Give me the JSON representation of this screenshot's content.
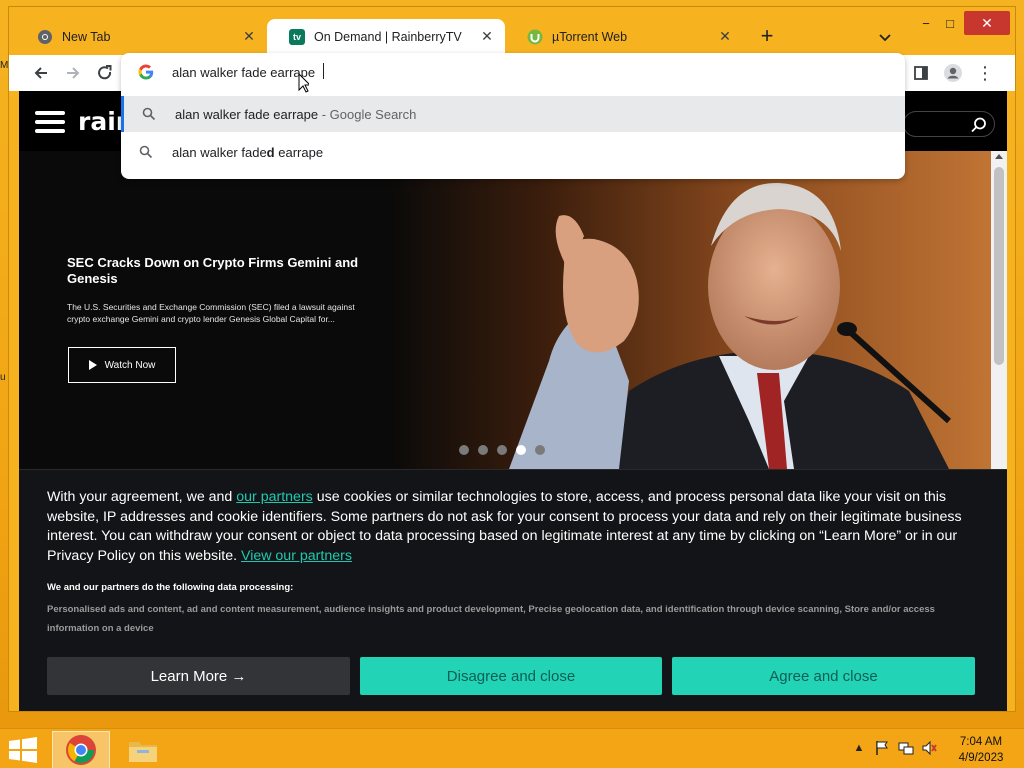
{
  "window": {
    "minimize": "−",
    "maximize": "□",
    "close": "✕"
  },
  "tabs": [
    {
      "title": "New Tab",
      "icon": "chrome-icon",
      "active": false
    },
    {
      "title": "On Demand | RainberryTV",
      "icon": "tv-icon",
      "favicon_text": "tv",
      "active": true
    },
    {
      "title": "µTorrent Web",
      "icon": "utorrent-icon",
      "active": false
    }
  ],
  "toolbar": {
    "new_tab": "+",
    "menu": "⋮"
  },
  "omnibox": {
    "value": "alan walker fade earrape",
    "suggestions": [
      {
        "query": "alan walker fade earrape",
        "suffix": " - Google Search",
        "selected": true
      },
      {
        "prefix": "alan walker fade",
        "bold": "d",
        "rest": " earrape",
        "selected": false
      }
    ]
  },
  "site": {
    "logo": "rain",
    "hero": {
      "title": "SEC Cracks Down on Crypto Firms Gemini and Genesis",
      "description": "The U.S. Securities and Exchange Commission (SEC) filed a lawsuit against crypto exchange Gemini and crypto lender Genesis Global Capital for...",
      "watch_label": "Watch Now",
      "slide_count": 5,
      "active_slide": 4
    }
  },
  "consent": {
    "text_before": "With your agreement, we and ",
    "link_partners": "our partners",
    "text_after": " use cookies or similar technologies to store, access, and process personal data like your visit on this website, IP addresses and cookie identifiers. Some partners do not ask for your consent to process your data and rely on their legitimate business interest. You can withdraw your consent or object to data processing based on legitimate interest at any time by clicking on “Learn More” or in our Privacy Policy on this website. ",
    "link_view": "View our partners",
    "processing_heading": "We and our partners do the following data processing:",
    "purposes": "Personalised ads and content, ad and content measurement, audience insights and product development, Precise geolocation data, and identification through device scanning, Store and/or access information on a device",
    "learn_more": "Learn More →",
    "disagree": "Disagree and close",
    "agree": "Agree and close"
  },
  "taskbar": {
    "time": "7:04 AM",
    "date": "4/9/2023"
  },
  "colors": {
    "accent_teal": "#22d3b6",
    "desktop_orange": "#f4a81a",
    "close_red": "#c7372d"
  }
}
